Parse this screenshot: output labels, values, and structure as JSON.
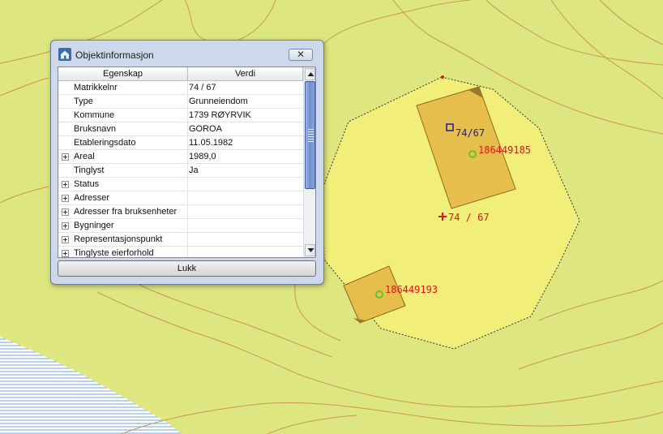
{
  "dialog": {
    "title": "Objektinformasjon",
    "close_label": "✕",
    "columns": [
      "Egenskap",
      "Verdi"
    ],
    "rows": [
      {
        "prop": "Matrikkelnr",
        "val": "74 / 67",
        "expandable": false
      },
      {
        "prop": "Type",
        "val": "Grunneiendom",
        "expandable": false
      },
      {
        "prop": "Kommune",
        "val": "1739  RØYRVIK",
        "expandable": false
      },
      {
        "prop": "Bruksnavn",
        "val": "GOROA",
        "expandable": false
      },
      {
        "prop": "Etableringsdato",
        "val": "11.05.1982",
        "expandable": false
      },
      {
        "prop": "Areal",
        "val": "1989,0",
        "expandable": true
      },
      {
        "prop": "Tinglyst",
        "val": "Ja",
        "expandable": false
      },
      {
        "prop": "Status",
        "val": "",
        "expandable": true
      },
      {
        "prop": "Adresser",
        "val": "",
        "expandable": true
      },
      {
        "prop": "Adresser fra bruksenheter",
        "val": "",
        "expandable": true
      },
      {
        "prop": "Bygninger",
        "val": "",
        "expandable": true
      },
      {
        "prop": "Representasjonspunkt",
        "val": "",
        "expandable": true
      },
      {
        "prop": "Tinglyste eierforhold",
        "val": "",
        "expandable": true
      }
    ],
    "button_label": "Lukk"
  },
  "map": {
    "labels": {
      "parcel_blue": "74/67",
      "parcel_red": "74 / 67",
      "building_1": "186449185",
      "building_2": "186449193"
    },
    "colors": {
      "terrain": "#dde67f",
      "parcel_fill": "#f1ef7a",
      "building_fill": "#e6be4c",
      "contour": "#c8965a",
      "water": "#6ea4dc",
      "label_red": "#e01515",
      "label_blue": "#1a1aa0",
      "point_green": "#33cc33"
    }
  }
}
